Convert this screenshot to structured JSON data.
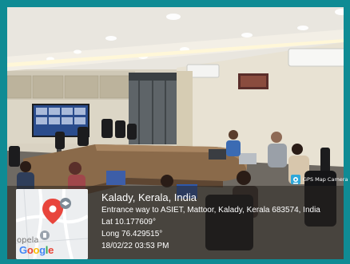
{
  "overlay": {
    "location_title": "Kalady, Kerala, India",
    "address": "Entrance way to ASIET, Mattoor, Kalady, Kerala 683574, India",
    "latitude": "Lat 10.177609°",
    "longitude": "Long 76.429515°",
    "datetime": "18/02/22 03:53 PM"
  },
  "map": {
    "place_label": "opela",
    "google_letters": [
      "G",
      "o",
      "o",
      "g",
      "l",
      "e"
    ]
  },
  "watermark": {
    "label": "GPS Map Camera"
  },
  "colors": {
    "frame": "#0f8b94",
    "pin": "#e8453c",
    "watermark_icon": "#2fa8d9"
  }
}
